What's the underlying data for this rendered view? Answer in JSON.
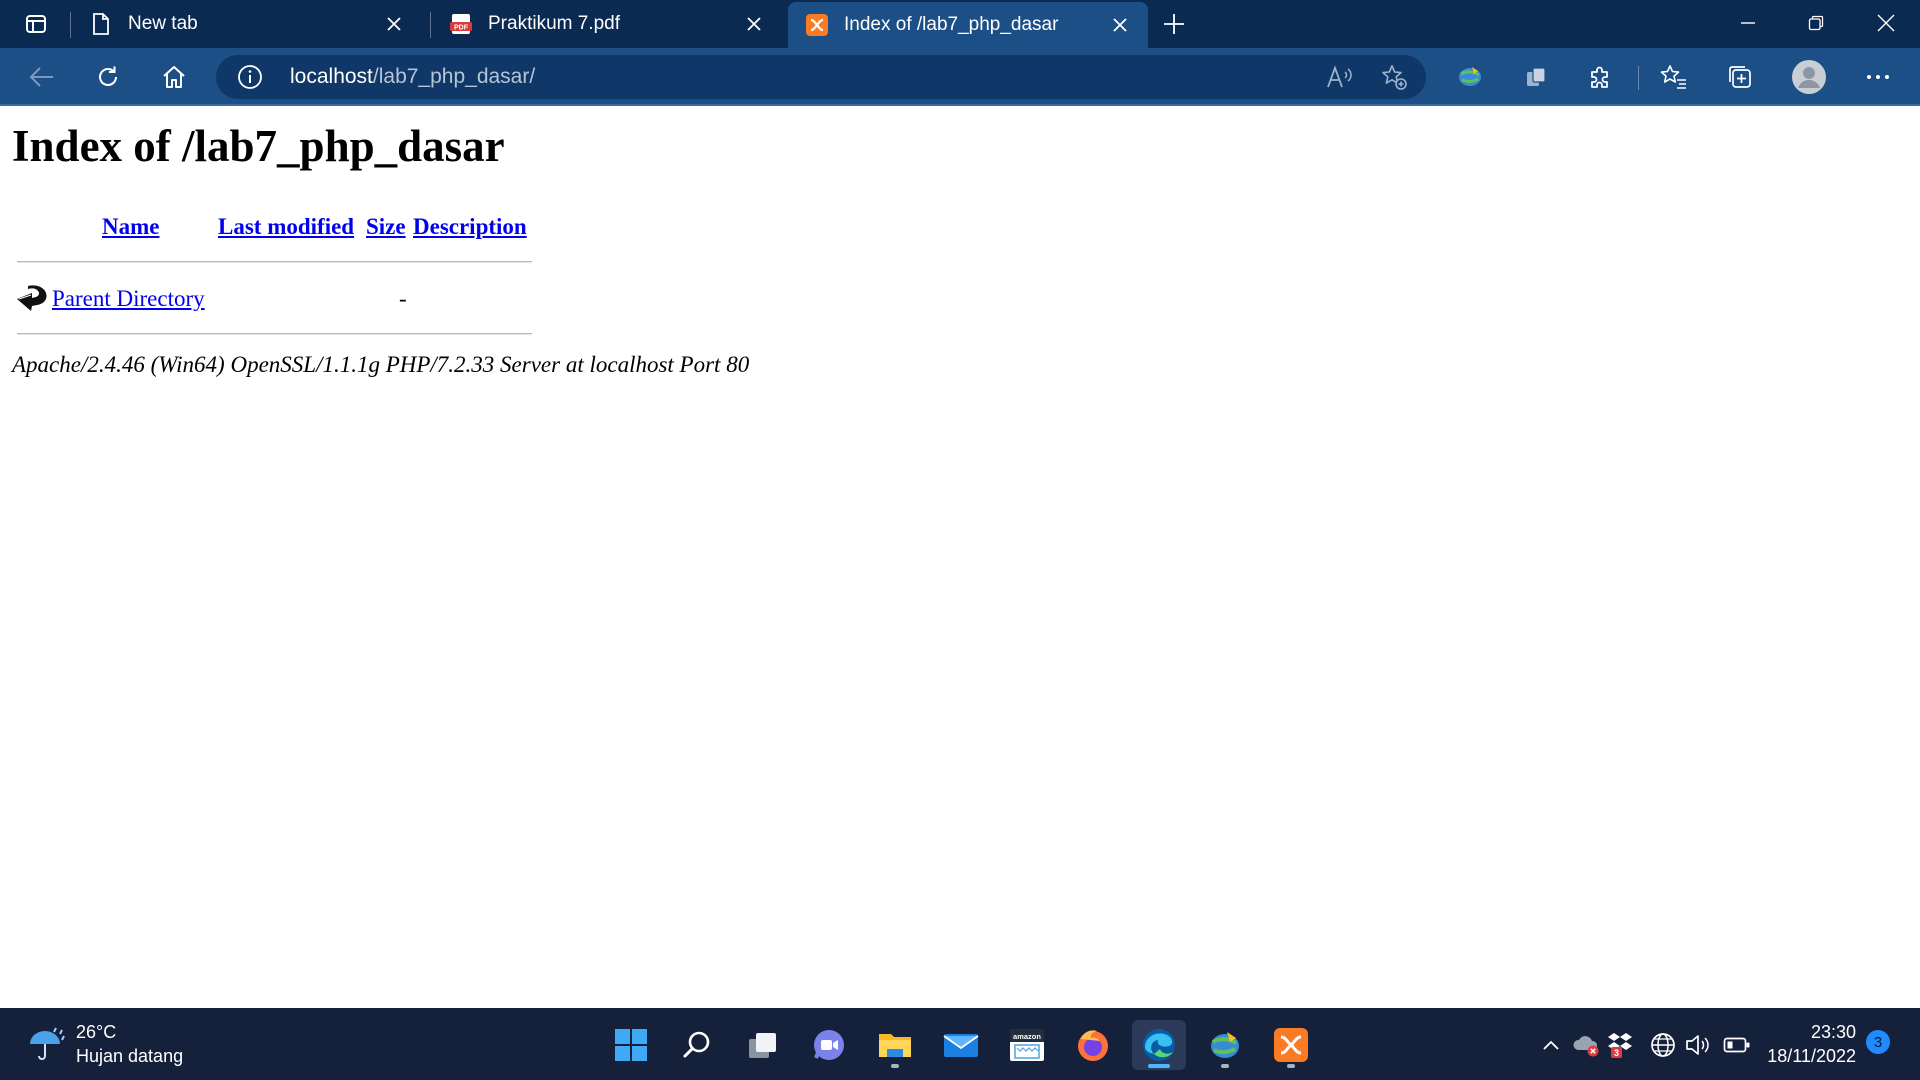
{
  "browser": {
    "tabs": [
      {
        "title": "New tab",
        "icon": "page-icon",
        "active": false
      },
      {
        "title": "Praktikum 7.pdf",
        "icon": "pdf-icon",
        "active": false
      },
      {
        "title": "Index of /lab7_php_dasar",
        "icon": "xampp-icon",
        "active": true
      }
    ],
    "address": {
      "host": "localhost",
      "path": "/lab7_php_dasar/"
    },
    "colors": {
      "tabstrip": "#0b2a52",
      "toolbar": "#1c4f86",
      "addressbar": "#0f3768"
    }
  },
  "page": {
    "heading": "Index of /lab7_php_dasar",
    "columns": {
      "name": "Name",
      "last_modified": "Last modified",
      "size": "Size",
      "description": "Description"
    },
    "rows": [
      {
        "name": "Parent Directory",
        "last_modified": "",
        "size": "-",
        "description": "",
        "icon": "back-arrow-icon"
      }
    ],
    "server_signature": "Apache/2.4.46 (Win64) OpenSSL/1.1.1g PHP/7.2.33 Server at localhost Port 80",
    "link_color": "#0000ee"
  },
  "taskbar": {
    "weather": {
      "temp": "26°C",
      "desc": "Hujan datang"
    },
    "apps": [
      "start",
      "search",
      "task-view",
      "teams-chat",
      "file-explorer",
      "mail",
      "amazon",
      "firefox",
      "edge",
      "idm",
      "xampp"
    ],
    "amazon_label": "amazon",
    "clock": {
      "time": "23:30",
      "date": "18/11/2022"
    },
    "notification_count": "3",
    "tray_badge": "3"
  }
}
